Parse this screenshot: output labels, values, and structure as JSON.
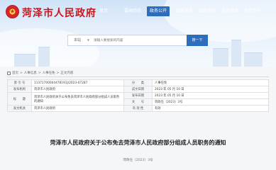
{
  "header": {
    "site_title": "菏泽市人民政府",
    "nav": [
      {
        "label": "首页",
        "active": false
      },
      {
        "label": "要闻动态",
        "active": false
      },
      {
        "label": "政务公开",
        "active": true
      },
      {
        "label": "政务服务",
        "active": false
      },
      {
        "label": "政民互动",
        "active": false
      },
      {
        "label": "走进菏泽",
        "active": false
      },
      {
        "label": "专题专栏",
        "active": false
      }
    ]
  },
  "search": {
    "category": "本站",
    "placeholder": "请输入要搜索的内容",
    "button_label": "搜一下"
  },
  "breadcrumb": {
    "items": [
      "首页",
      "人事信息",
      "人事任免",
      "正文内容"
    ]
  },
  "info_table": {
    "rows": [
      {
        "l1": "索 引 号",
        "v1": "11371700004478191J/2023-07287",
        "l2": "分　　类",
        "v2": "人事任免"
      },
      {
        "l1": "发布机构",
        "v1": "菏泽市人民政府",
        "l2": "成文日期",
        "v2": "2023 年 05 月 10 日"
      },
      {
        "l1": "标　　题",
        "v1": "菏泽市人民政府关于公布免去菏泽市人民政府部分组成人员职务的通知",
        "l2": "发布日期",
        "v2": "2023 年 05 月 10 日"
      },
      {
        "l1": "",
        "v1": "",
        "l2": "文　　号",
        "v2": "菏政任〔2023〕3号"
      },
      {
        "l1": "发文机关",
        "v1": "菏泽市人民政府",
        "l2": "有 效 性",
        "v2": "有效"
      }
    ]
  },
  "document": {
    "title": "菏泽市人民政府关于公布免去菏泽市人民政府部分组成人员职务的通知",
    "number": "菏政任〔2023〕3号"
  }
}
